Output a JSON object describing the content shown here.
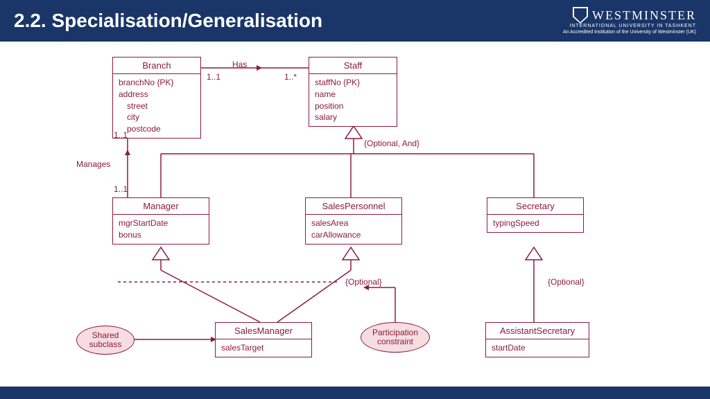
{
  "header": {
    "title": "2.2. Specialisation/Generalisation",
    "logo_main": "WESTMINSTER",
    "logo_sub": "INTERNATIONAL UNIVERSITY IN TASHKENT",
    "logo_desc": "An Accredited Institution of the University of Westminster (UK)"
  },
  "entities": {
    "branch": {
      "name": "Branch",
      "attrs": [
        "branchNo {PK}",
        "address",
        "street",
        "city",
        "postcode"
      ]
    },
    "staff": {
      "name": "Staff",
      "attrs": [
        "staffNo {PK}",
        "name",
        "position",
        "salary"
      ]
    },
    "manager": {
      "name": "Manager",
      "attrs": [
        "mgrStartDate",
        "bonus"
      ]
    },
    "salesPersonnel": {
      "name": "SalesPersonnel",
      "attrs": [
        "salesArea",
        "carAllowance"
      ]
    },
    "secretary": {
      "name": "Secretary",
      "attrs": [
        "typingSpeed"
      ]
    },
    "salesManager": {
      "name": "SalesManager",
      "attrs": [
        "salesTarget"
      ]
    },
    "assistantSecretary": {
      "name": "AssistantSecretary",
      "attrs": [
        "startDate"
      ]
    }
  },
  "relations": {
    "has": {
      "label": "Has",
      "mult_left": "1..1",
      "mult_right": "1..*"
    },
    "manages": {
      "label": "Manages",
      "mult_top": "1..1",
      "mult_bottom": "1..1"
    }
  },
  "constraints": {
    "optionalAnd": "{Optional, And}",
    "optional1": "{Optional}",
    "optional2": "{Optional}"
  },
  "notes": {
    "shared": "Shared subclass",
    "participation": "Participation constraint"
  }
}
